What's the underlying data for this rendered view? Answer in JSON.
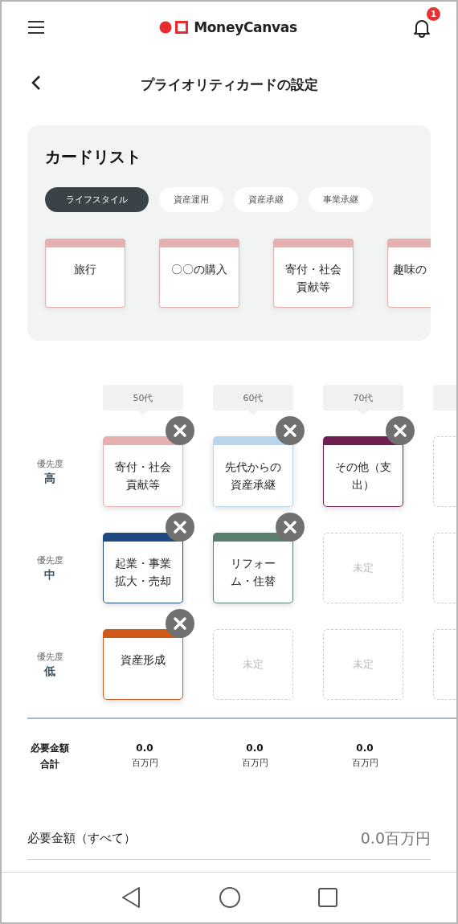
{
  "header": {
    "logo": "MoneyCanvas",
    "notification_count": "1"
  },
  "page_title": "プライオリティカードの設定",
  "card_list": {
    "title": "カードリスト",
    "categories": [
      {
        "label": "ライフスタイル",
        "selected": true
      },
      {
        "label": "資産運用",
        "selected": false
      },
      {
        "label": "資産承継",
        "selected": false
      },
      {
        "label": "事業承継",
        "selected": false
      }
    ],
    "cards": [
      {
        "text": "旅行",
        "color": "#e4b0b0"
      },
      {
        "text": "〇〇の購入",
        "color": "#e4b0b0"
      },
      {
        "text": "寄付・社会貢献等",
        "color": "#e4b0b0"
      },
      {
        "text": "趣味の",
        "color": "#e4b0b0"
      }
    ]
  },
  "age_columns": [
    "50代",
    "60代",
    "70代"
  ],
  "priority_rows": [
    {
      "caption": "優先度",
      "level": "高",
      "slots": [
        {
          "kind": "card",
          "text": "寄付・社会貢献等",
          "color": "#e4b0b0"
        },
        {
          "kind": "card",
          "text": "先代からの資産承継",
          "color": "#b7d6ee"
        },
        {
          "kind": "card",
          "text": "その他（支出）",
          "color": "#6e1f4f"
        },
        {
          "kind": "empty"
        }
      ]
    },
    {
      "caption": "優先度",
      "level": "中",
      "slots": [
        {
          "kind": "card",
          "text": "起業・事業拡大・売却",
          "color": "#1e4a80"
        },
        {
          "kind": "card",
          "text": "リフォーム・住替",
          "color": "#5a7f6c"
        },
        {
          "kind": "empty",
          "text": "未定"
        },
        {
          "kind": "empty"
        }
      ]
    },
    {
      "caption": "優先度",
      "level": "低",
      "slots": [
        {
          "kind": "card",
          "text": "資産形成",
          "color": "#d05a1a"
        },
        {
          "kind": "empty",
          "text": "未定"
        },
        {
          "kind": "empty",
          "text": "未定"
        },
        {
          "kind": "empty"
        }
      ]
    }
  ],
  "totals": {
    "label": "必要金額合計",
    "values": [
      {
        "amount": "0.0",
        "unit": "百万円"
      },
      {
        "amount": "0.0",
        "unit": "百万円"
      },
      {
        "amount": "0.0",
        "unit": "百万円"
      }
    ]
  },
  "grand_total": {
    "label": "必要金額（すべて）",
    "value": "0.0百万円"
  }
}
